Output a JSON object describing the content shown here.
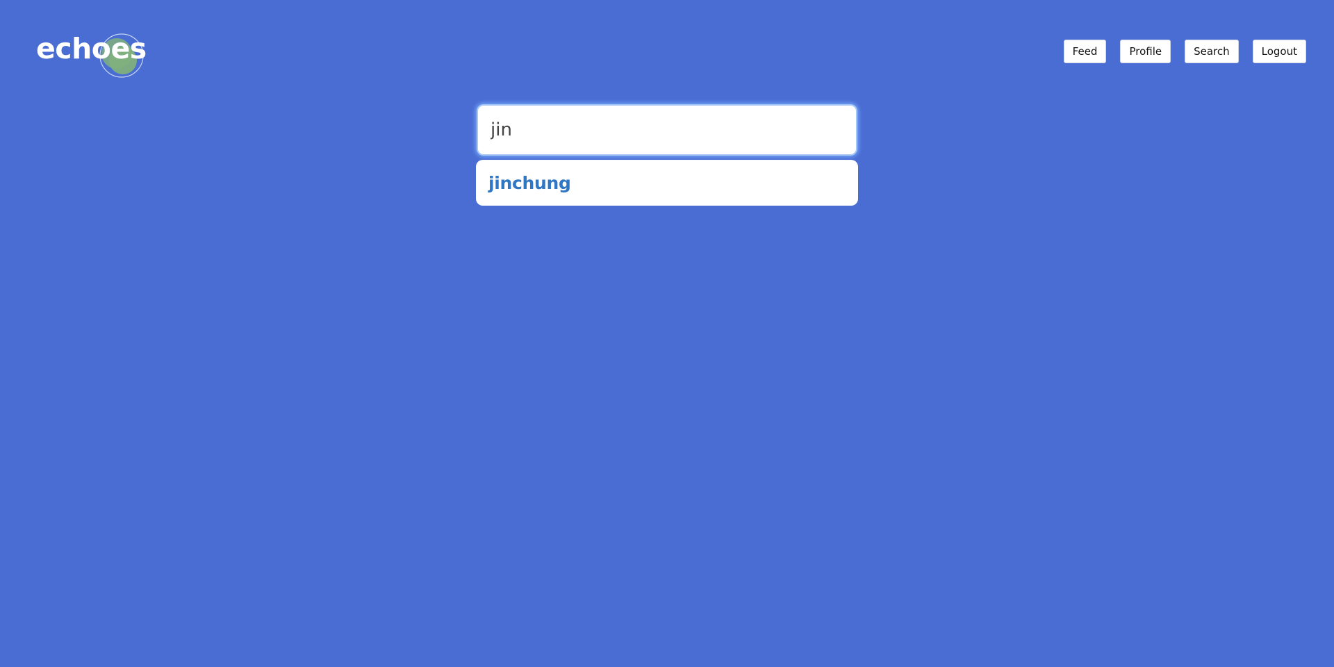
{
  "app": {
    "logo_text": "echoes",
    "colors": {
      "background": "#4a6dd3",
      "logo_circle_fill": "#7fb07d",
      "logo_circle_outline": "#c9d6f5",
      "result_link": "#2f77c4"
    }
  },
  "nav": {
    "items": [
      {
        "label": "Feed"
      },
      {
        "label": "Profile"
      },
      {
        "label": "Search"
      },
      {
        "label": "Logout"
      }
    ]
  },
  "search": {
    "value": "jin",
    "results": [
      {
        "username": "jinchung"
      }
    ]
  }
}
